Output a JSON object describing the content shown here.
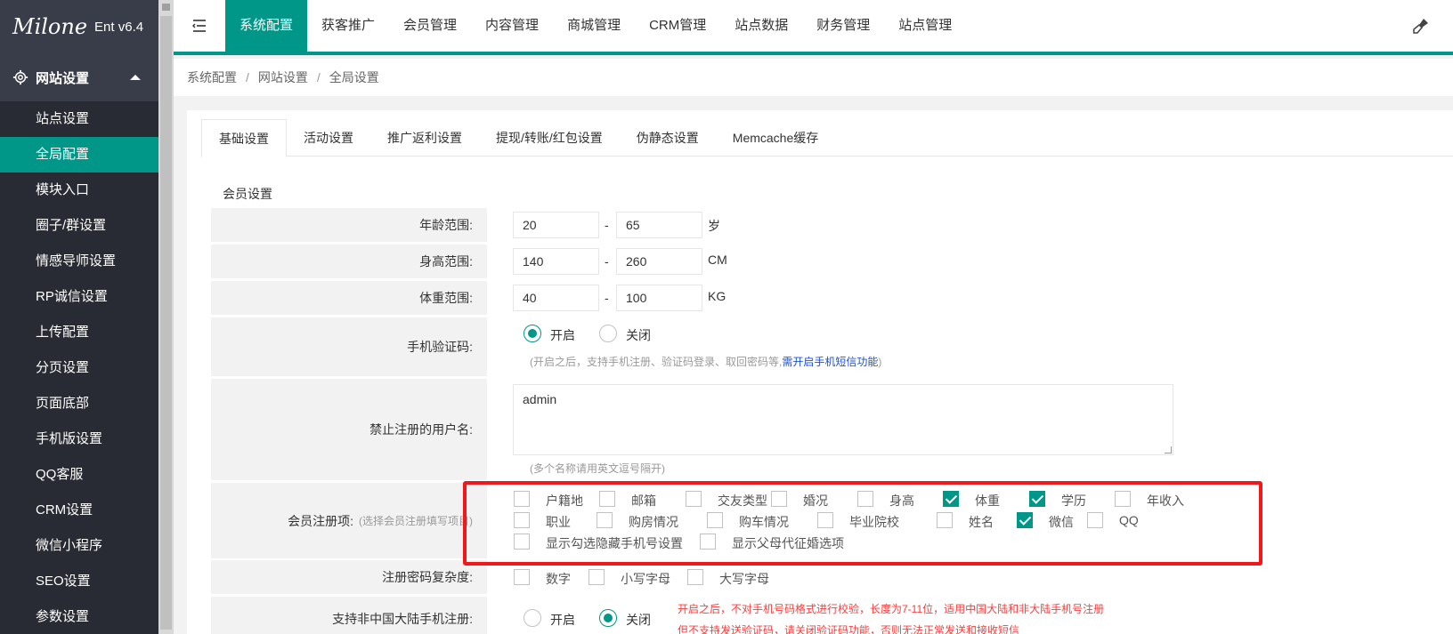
{
  "app": {
    "logo_script": "Milone",
    "version": "Ent v6.4"
  },
  "sidebar": {
    "group_label": "网站设置",
    "items": [
      {
        "label": "站点设置",
        "active": false
      },
      {
        "label": "全局配置",
        "active": true
      },
      {
        "label": "模块入口",
        "active": false
      },
      {
        "label": "圈子/群设置",
        "active": false
      },
      {
        "label": "情感导师设置",
        "active": false
      },
      {
        "label": "RP诚信设置",
        "active": false
      },
      {
        "label": "上传配置",
        "active": false
      },
      {
        "label": "分页设置",
        "active": false
      },
      {
        "label": "页面底部",
        "active": false
      },
      {
        "label": "手机版设置",
        "active": false
      },
      {
        "label": "QQ客服",
        "active": false
      },
      {
        "label": "CRM设置",
        "active": false
      },
      {
        "label": "微信小程序",
        "active": false
      },
      {
        "label": "SEO设置",
        "active": false
      },
      {
        "label": "参数设置",
        "active": false
      }
    ]
  },
  "topnav": {
    "items": [
      {
        "label": "系统配置",
        "active": true
      },
      {
        "label": "获客推广",
        "active": false
      },
      {
        "label": "会员管理",
        "active": false
      },
      {
        "label": "内容管理",
        "active": false
      },
      {
        "label": "商城管理",
        "active": false
      },
      {
        "label": "CRM管理",
        "active": false
      },
      {
        "label": "站点数据",
        "active": false
      },
      {
        "label": "财务管理",
        "active": false
      },
      {
        "label": "站点管理",
        "active": false
      }
    ]
  },
  "breadcrumb": {
    "items": [
      "系统配置",
      "网站设置",
      "全局设置"
    ],
    "separator": "/"
  },
  "tabs": [
    "基础设置",
    "活动设置",
    "推广返利设置",
    "提现/转账/红包设置",
    "伪静态设置",
    "Memcache缓存"
  ],
  "form": {
    "section_title": "会员设置",
    "age": {
      "label": "年龄范围:",
      "min": "20",
      "max": "65",
      "unit": "岁"
    },
    "height": {
      "label": "身高范围:",
      "min": "140",
      "max": "260",
      "unit": "CM"
    },
    "weight": {
      "label": "体重范围:",
      "min": "40",
      "max": "100",
      "unit": "KG"
    },
    "range_dash": "-",
    "phone_verify": {
      "label": "手机验证码:",
      "on": "开启",
      "off": "关闭",
      "value": "on",
      "note": "(开启之后，支持手机注册、验证码登录、取回密码等,",
      "note_link": "需开启手机短信功能",
      "note_end": ")"
    },
    "banned_names": {
      "label": "禁止注册的用户名:",
      "value": "admin",
      "note": "(多个名称请用英文逗号隔开)"
    },
    "reg_items": {
      "label": "会员注册项:",
      "hint": "(选择会员注册填写项目)",
      "options": [
        {
          "label": "户籍地",
          "checked": false
        },
        {
          "label": "邮箱",
          "checked": false
        },
        {
          "label": "交友类型",
          "checked": false
        },
        {
          "label": "婚况",
          "checked": false
        },
        {
          "label": "身高",
          "checked": false
        },
        {
          "label": "体重",
          "checked": true
        },
        {
          "label": "学历",
          "checked": true
        },
        {
          "label": "年收入",
          "checked": false
        },
        {
          "label": "职业",
          "checked": false
        },
        {
          "label": "购房情况",
          "checked": false
        },
        {
          "label": "购车情况",
          "checked": false
        },
        {
          "label": "毕业院校",
          "checked": false
        },
        {
          "label": "姓名",
          "checked": false
        },
        {
          "label": "微信",
          "checked": true
        },
        {
          "label": "QQ",
          "checked": false
        },
        {
          "label": "显示勾选隐藏手机号设置",
          "checked": false
        },
        {
          "label": "显示父母代征婚选项",
          "checked": false
        }
      ]
    },
    "pwd_complexity": {
      "label": "注册密码复杂度:",
      "options": [
        {
          "label": "数字",
          "checked": false
        },
        {
          "label": "小写字母",
          "checked": false
        },
        {
          "label": "大写字母",
          "checked": false
        }
      ]
    },
    "intl_phone": {
      "label": "支持非中国大陆手机注册:",
      "on": "开启",
      "off": "关闭",
      "value": "off",
      "warn1": "开启之后，不对手机号码格式进行校验，长度为7-11位，适用中国大陆和非大陆手机号注册",
      "warn2": "但不支持发送验证码，请关闭验证码功能，否则无法正常发送和接收短信"
    }
  }
}
